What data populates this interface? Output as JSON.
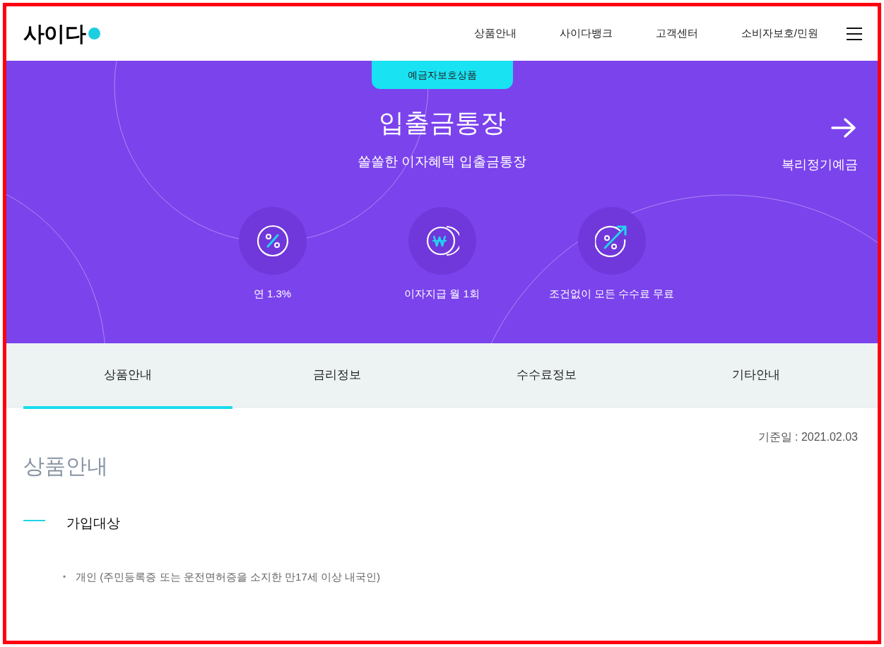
{
  "header": {
    "logo": "사이다",
    "nav": [
      "상품안내",
      "사이다뱅크",
      "고객센터",
      "소비자보호/민원"
    ]
  },
  "hero": {
    "badge": "예금자보호상품",
    "title": "입출금통장",
    "subtitle": "쏠쏠한 이자혜택 입출금통장",
    "next_product": "복리정기예금",
    "features": [
      {
        "kind": "percent",
        "label": "연 1.3%"
      },
      {
        "kind": "won",
        "label": "이자지급 월 1회"
      },
      {
        "kind": "fee",
        "label": "조건없이 모든 수수료 무료"
      }
    ]
  },
  "tabs": [
    {
      "label": "상품안내",
      "selected": true
    },
    {
      "label": "금리정보",
      "selected": false
    },
    {
      "label": "수수료정보",
      "selected": false
    },
    {
      "label": "기타안내",
      "selected": false
    }
  ],
  "content": {
    "base_date": "기준일 : 2021.02.03",
    "title": "상품안내",
    "section": "가입대상",
    "items": [
      {
        "bullet": "•",
        "text": "개인 (주민등록증 또는 운전면허증을 소지한 만17세 이상 내국인)"
      }
    ]
  }
}
